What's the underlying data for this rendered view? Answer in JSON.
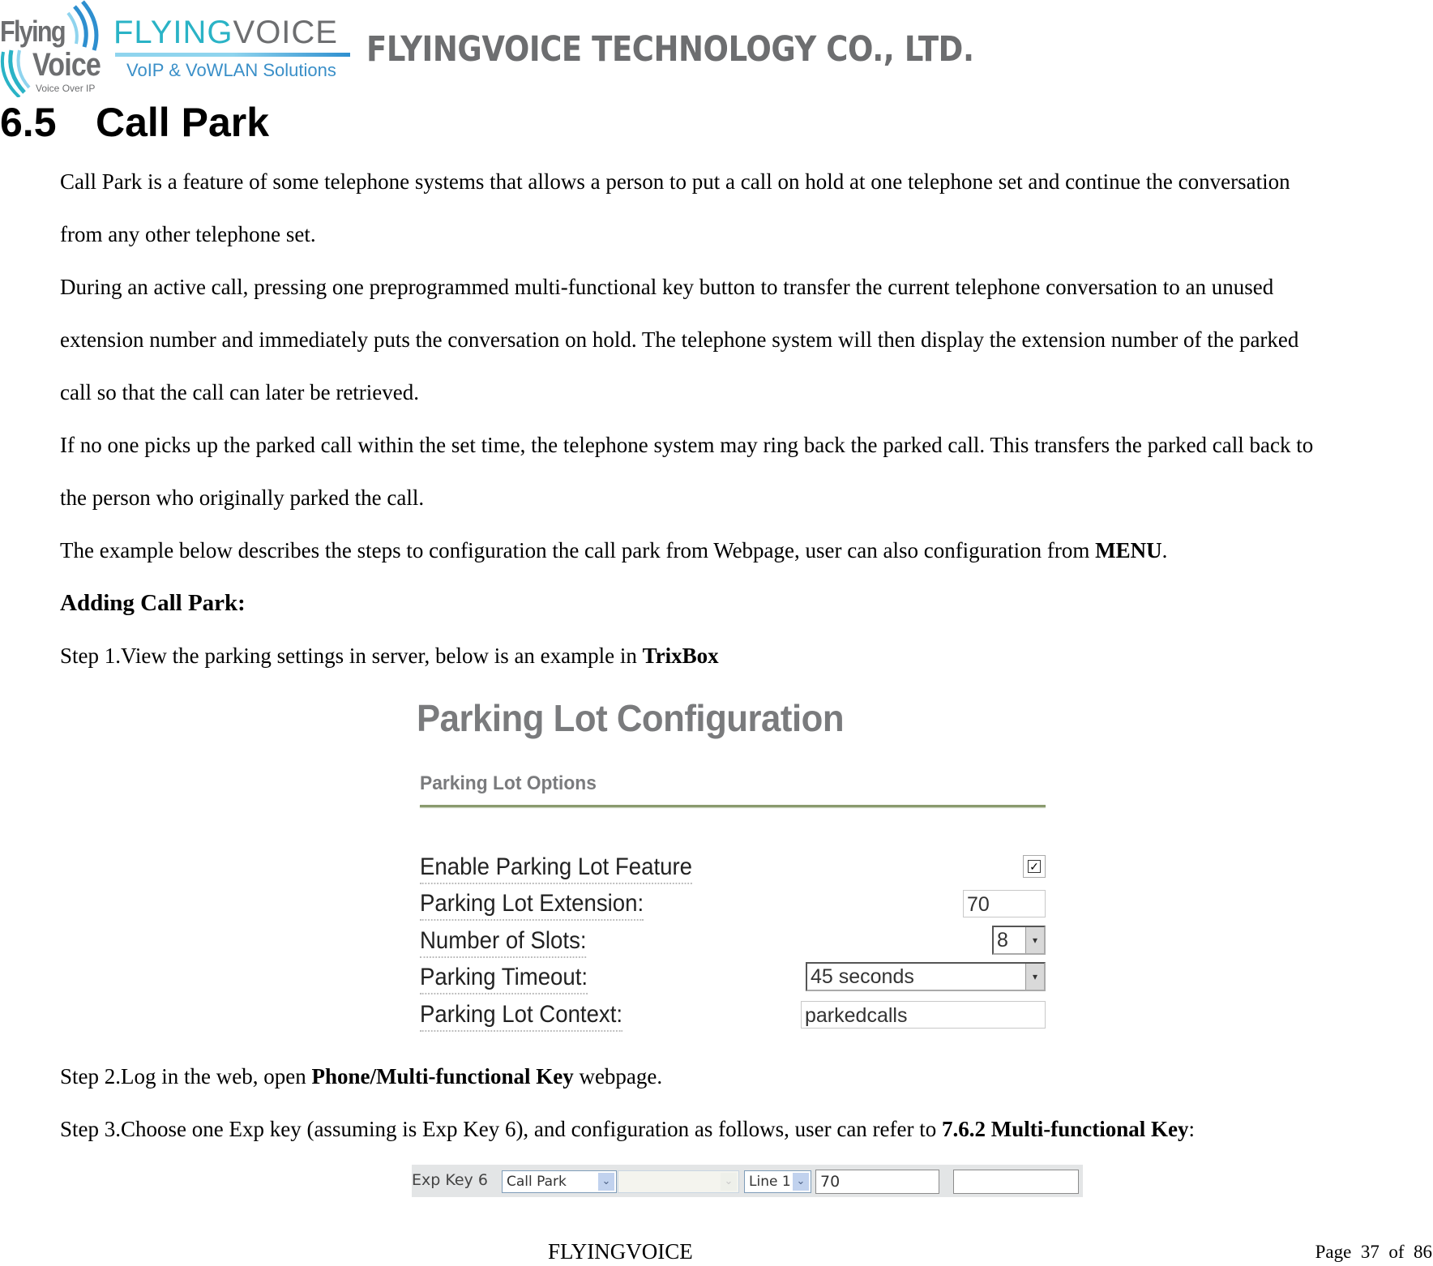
{
  "header": {
    "logo_left_top": "Flying",
    "logo_left_bottom": "Voice",
    "logo_left_tag": "Voice Over IP",
    "logo_brand_a": "FLYING",
    "logo_brand_b": "VOICE",
    "logo_tagline": "VoIP & VoWLAN Solutions",
    "company": "FLYINGVOICE TECHNOLOGY CO., LTD."
  },
  "section": {
    "number": "6.5",
    "title": "Call Park"
  },
  "paragraphs": {
    "p1_l1": "Call Park is a feature of some telephone systems that allows a person to put a call on hold at one telephone set and continue the conversation",
    "p1_l2": "from any other telephone set.",
    "p2_l1": "During an active call, pressing one preprogrammed multi-functional key button to transfer the current telephone conversation to an unused",
    "p2_l2": "extension number and immediately puts the conversation on hold. The telephone system will then display the extension number of the parked",
    "p2_l3": "call so that the call can later be retrieved.",
    "p3_l1": "If no one picks up the parked call within the set time, the telephone system may ring back the parked call. This transfers the parked call back to",
    "p3_l2": "the person who originally parked the call.",
    "p4_pre": "The example below describes the steps to configuration the call park from Webpage, user can also configuration from ",
    "p4_bold": "MENU",
    "p4_post": ".",
    "heading_adding": "Adding Call Park:",
    "step1_pre": "Step 1.View the parking settings in server, below is an example in ",
    "step1_bold": "TrixBox",
    "step2_pre": "Step 2.Log in the web, open ",
    "step2_bold": "Phone/Multi-functional Key",
    "step2_post": " webpage.",
    "step3_pre": "Step 3.Choose one Exp key (assuming is Exp Key 6), and configuration as follows, user can refer to ",
    "step3_bold": "7.6.2 Multi-functional Key",
    "step3_post": ":"
  },
  "parking_lot": {
    "title": "Parking Lot Configuration",
    "subtitle": "Parking Lot Options",
    "enable_label": "Enable Parking Lot Feature",
    "enable_checked": true,
    "enable_mark": "✓",
    "extension_label": "Parking Lot Extension:",
    "extension_value": "70",
    "slots_label": "Number of Slots:",
    "slots_value": "8",
    "timeout_label": "Parking Timeout:",
    "timeout_value": "45 seconds",
    "context_label": "Parking Lot Context:",
    "context_value": "parkedcalls",
    "dropdown_glyph": "▾"
  },
  "exp_key": {
    "label": "Exp Key 6",
    "type_value": "Call Park",
    "account_value": "",
    "line_value": "Line 1",
    "value_field": "70",
    "extra_field": "",
    "dropdown_glyph": "⌄"
  },
  "footer": {
    "brand": "FLYINGVOICE",
    "page_label": "Page",
    "page_current": "37",
    "page_of": "of",
    "page_total": "86"
  }
}
